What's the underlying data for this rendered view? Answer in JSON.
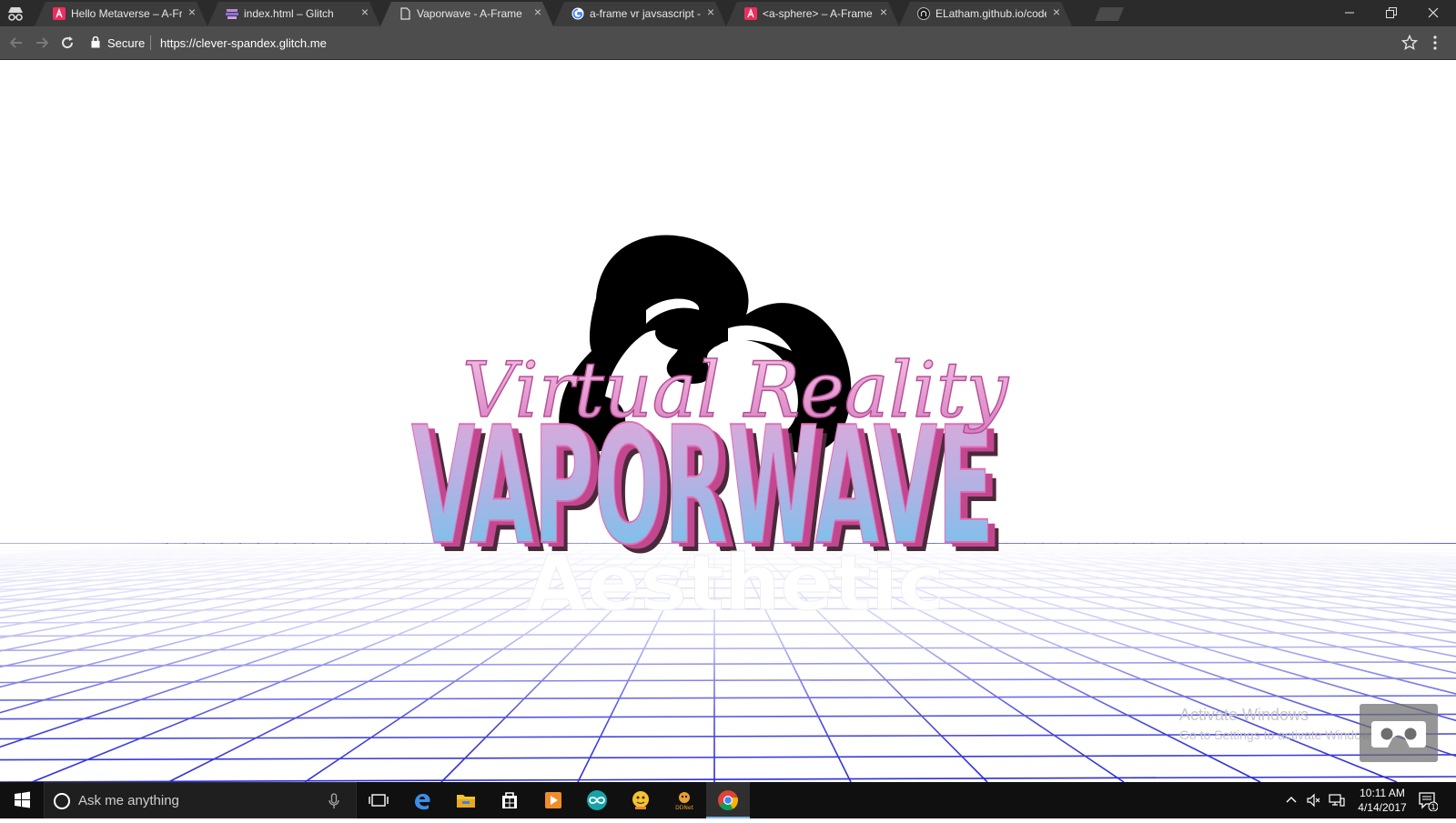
{
  "browser": {
    "tabs": [
      {
        "title": "Hello Metaverse – A-Frame",
        "favicon": "aframe-icon",
        "active": false
      },
      {
        "title": "index.html – Glitch",
        "favicon": "glitch-icon",
        "active": false
      },
      {
        "title": "Vaporwave - A-Frame",
        "favicon": "page-icon",
        "active": true
      },
      {
        "title": "a-frame vr javsascript - Google Search",
        "favicon": "google-icon",
        "active": false
      },
      {
        "title": "<a-sphere> – A-Frame",
        "favicon": "aframe-icon",
        "active": false
      },
      {
        "title": "ELatham.github.io/code at master",
        "favicon": "github-icon",
        "active": false
      }
    ],
    "close_glyph": "×",
    "security_label": "Secure",
    "url": "https://clever-spandex.glitch.me"
  },
  "scene": {
    "script_text": "Virtual Reality",
    "title_text": "VAPORWAVE",
    "subtitle_text": "Aesthetic",
    "colors": {
      "script_pink": "#e59ad0",
      "title_top": "#e6a6d6",
      "title_bottom": "#6ccbf0",
      "title_side": "#c2478f",
      "title_shadow": "#4a2a3a",
      "grid": "#2c2cd8",
      "sphere": "#000000"
    }
  },
  "watermark": {
    "line1": "Activate Windows",
    "line2": "Go to Settings to activate Windows."
  },
  "vr_button_icon": "cardboard-vr-icon",
  "taskbar": {
    "search_placeholder": "Ask me anything",
    "pinned": [
      "task-view-icon",
      "edge-icon",
      "file-explorer-icon",
      "store-icon",
      "media-player-icon",
      "arduino-icon",
      "emoji-app-icon",
      "ddnet-icon",
      "chrome-icon"
    ],
    "ddnet_label": "DDNet",
    "time": "10:11 AM",
    "date": "4/14/2017",
    "notification_count": "1"
  }
}
